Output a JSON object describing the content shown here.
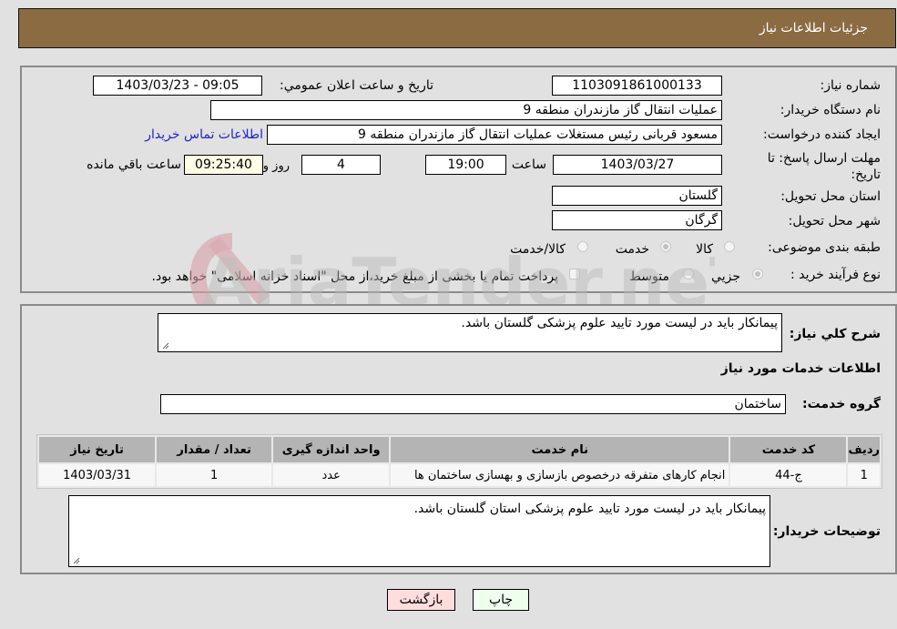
{
  "header": {
    "title": "جزئیات اطلاعات نیاز"
  },
  "form": {
    "need_number_label": "شماره نیاز:",
    "need_number": "1103091861000133",
    "announce_label": "تاریخ و ساعت اعلان عمومي:",
    "announce_value": "1403/03/23 - 09:05",
    "buyer_org_label": "نام دستگاه خریدار:",
    "buyer_org": "عملیات انتقال گاز مازندران منطقه 9",
    "creator_label": "ایجاد کننده درخواست:",
    "creator": "مسعود قربانی رئیس مستغلات عملیات انتقال گاز مازندران منطقه 9",
    "contact_link": "اطلاعات تماس خریدار",
    "deadline_label": "مهلت ارسال پاسخ: تا تاریخ:",
    "deadline_date": "1403/03/27",
    "time_label": "ساعت",
    "deadline_time": "19:00",
    "days_value": "4",
    "days_label": "روز و",
    "remaining_time": "09:25:40",
    "remaining_label": "ساعت باقي مانده",
    "province_label": "استان محل تحویل:",
    "province": "گلستان",
    "city_label": "شهر محل تحویل:",
    "city": "گرگان",
    "category_label": "طبقه بندی موضوعی:",
    "category_options": [
      {
        "label": "کالا",
        "checked": false
      },
      {
        "label": "خدمت",
        "checked": true
      },
      {
        "label": "کالا/خدمت",
        "checked": false
      }
    ],
    "process_label": "نوع فرآیند خرید :",
    "process_options": [
      {
        "label": "جزیي",
        "checked": true
      },
      {
        "label": "متوسط",
        "checked": false
      }
    ],
    "treasury_note": "پرداخت تمام یا بخشی از مبلغ خرید،از محل \"اسناد خزانه اسلامی\" خواهد بود."
  },
  "details": {
    "description_label": "شرح کلي نیاز:",
    "description": "پیمانکار باید در لیست مورد تایید علوم پزشکی گلستان باشد.",
    "services_title": "اطلاعات خدمات مورد نیاز",
    "service_group_label": "گروه خدمت:",
    "service_group": "ساختمان",
    "table": {
      "headers": [
        "ردیف",
        "کد خدمت",
        "نام خدمت",
        "واحد اندازه گیری",
        "تعداد / مقدار",
        "تاریخ نیاز"
      ],
      "rows": [
        [
          "1",
          "ج-44",
          "انجام کارهای متفرقه درخصوص بازسازی و بهسازی ساختمان ها",
          "عدد",
          "1",
          "1403/03/31"
        ]
      ]
    },
    "buyer_notes_label": "توضیحات خریدار:",
    "buyer_notes": "پیمانکار باید در لیست مورد تایید علوم پزشکی استان گلستان باشد."
  },
  "buttons": {
    "print": "چاپ",
    "back": "بازگشت"
  },
  "watermark": {
    "text": "AriaTender.neT"
  },
  "colors": {
    "header_bg": "#8b6b42",
    "print_bg": "#eeffee",
    "back_bg": "#ffdddd",
    "link": "#2222cc"
  }
}
